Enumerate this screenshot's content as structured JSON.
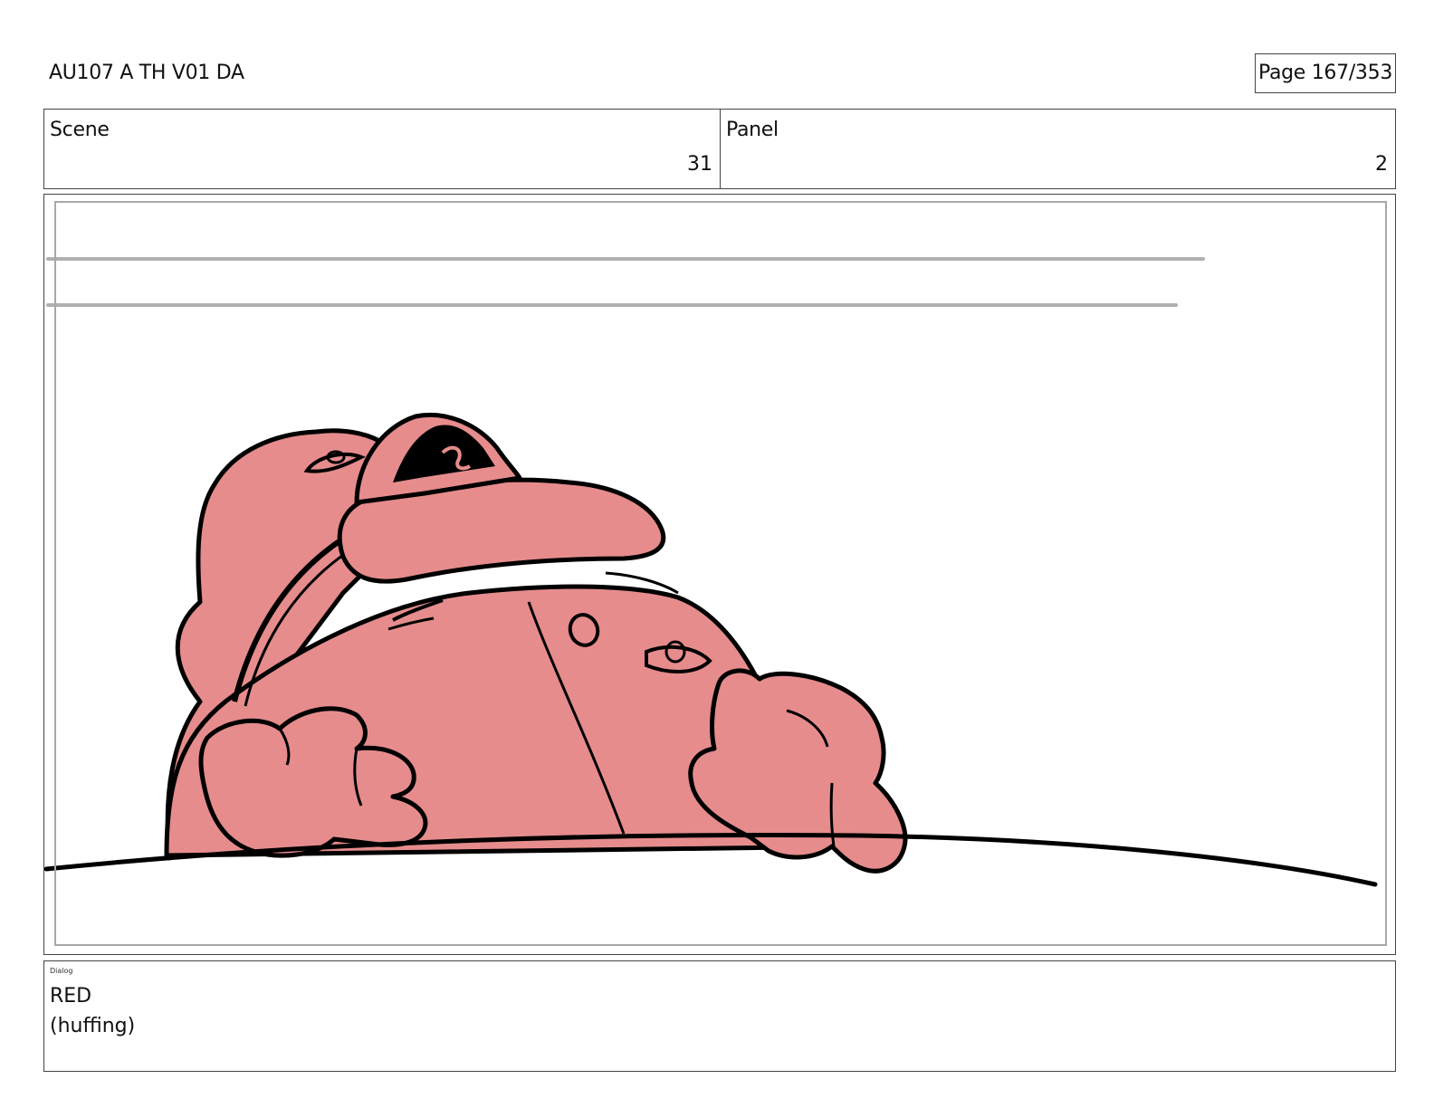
{
  "header": {
    "doc_title": "AU107 A TH V01 DA",
    "page_label": "Page 167/353"
  },
  "info": {
    "scene_label": "Scene",
    "scene_value": "31",
    "panel_label": "Panel",
    "panel_value": "2"
  },
  "artwork": {
    "description_icon": "storyboard-drawing",
    "fill_color": "#E68C8C",
    "line_color": "#000000",
    "guide_color": "#B0B0B0"
  },
  "dialog": {
    "label": "Dialog",
    "line1": "RED",
    "line2": "(huffing)"
  }
}
